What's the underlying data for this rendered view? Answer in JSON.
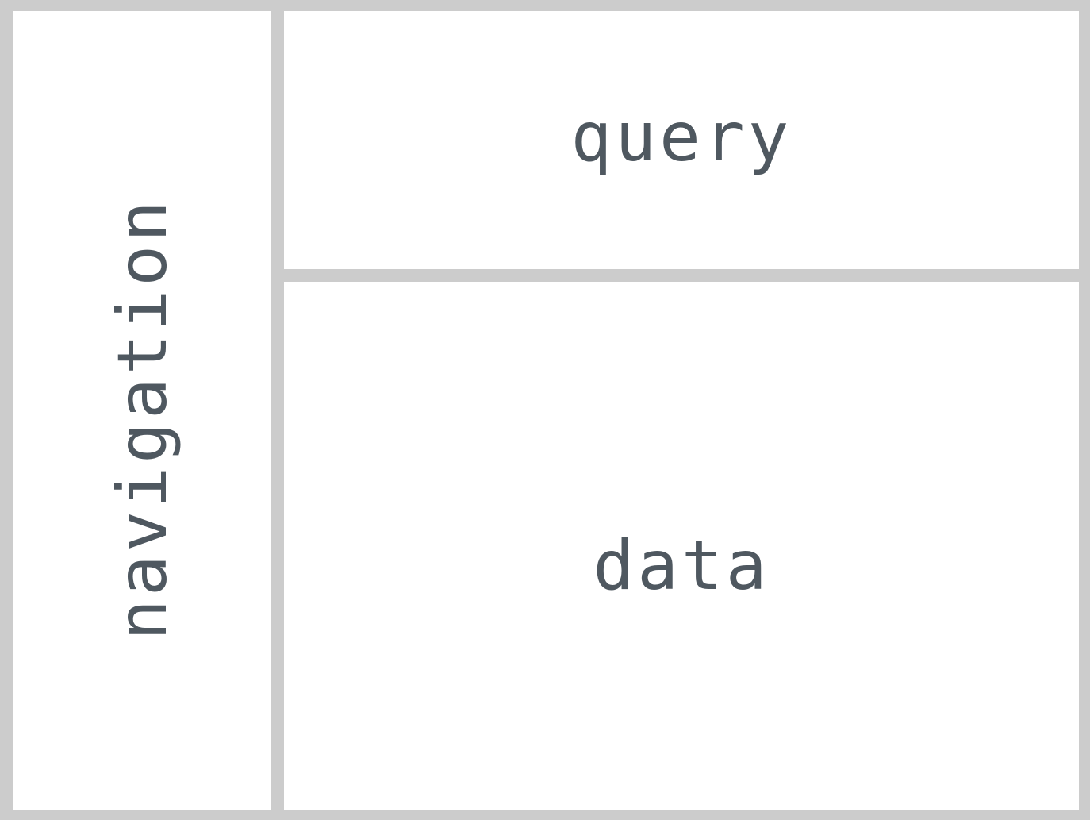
{
  "panels": {
    "navigation": {
      "label": "navigation"
    },
    "query": {
      "label": "query"
    },
    "data": {
      "label": "data"
    }
  },
  "colors": {
    "border": "#cccccc",
    "panel_background": "#ffffff",
    "text": "#4f5860"
  }
}
